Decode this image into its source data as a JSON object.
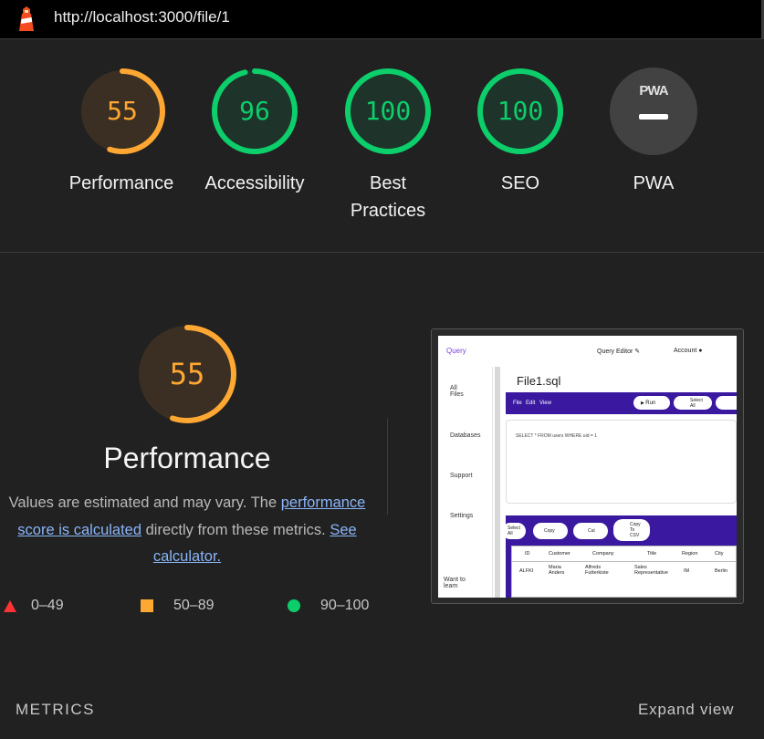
{
  "browser": {
    "url": "http://localhost:3000/file/1"
  },
  "categories": [
    {
      "label": "Performance",
      "score": "55",
      "value": 55,
      "color": "#ffa733"
    },
    {
      "label": "Accessibility",
      "score": "96",
      "value": 96,
      "color": "#0cce6b"
    },
    {
      "label": "Best\nPractices",
      "label_line1": "Best",
      "label_line2": "Practices",
      "score": "100",
      "value": 100,
      "color": "#0cce6b"
    },
    {
      "label": "SEO",
      "score": "100",
      "value": 100,
      "color": "#0cce6b"
    },
    {
      "label": "PWA",
      "badge": "PWA",
      "color": "#9e9e9e"
    }
  ],
  "performance": {
    "score": "55",
    "value": 55,
    "title": "Performance",
    "desc_prefix": "Values are estimated and may vary. The ",
    "desc_link1": "performance score is calculated",
    "desc_mid": " directly from these metrics. ",
    "desc_link2": "See calculator."
  },
  "legend": [
    {
      "range": "0–49",
      "shape": "triangle",
      "color": "#ff3333"
    },
    {
      "range": "50–89",
      "shape": "square",
      "color": "#ffa733"
    },
    {
      "range": "90–100",
      "shape": "circle",
      "color": "#0cce6b"
    }
  ],
  "footer": {
    "metrics": "METRICS",
    "expand": "Expand view"
  },
  "screenshot": {
    "brand": "Query",
    "query_editor": "Query Editor",
    "account": "Account",
    "sidebar": [
      "All Files",
      "Databases",
      "Support",
      "Settings",
      "Want to learn"
    ],
    "file_title": "File1.sql",
    "menu": [
      "File",
      "Edit",
      "View"
    ],
    "run": "Run",
    "select_all": "Select All",
    "query": "SELECT * FROM users WHERE uid = 1",
    "copy": "Copy",
    "cut": "Cut",
    "copy_csv": "Copy To CSV",
    "columns": [
      "ID",
      "Customer",
      "Company",
      "Title",
      "Region",
      "City"
    ],
    "row": [
      "ALFKI",
      "Maria Anders",
      "Alfreds Futterkiste",
      "Sales Representative",
      "IM",
      "Berlin"
    ]
  }
}
